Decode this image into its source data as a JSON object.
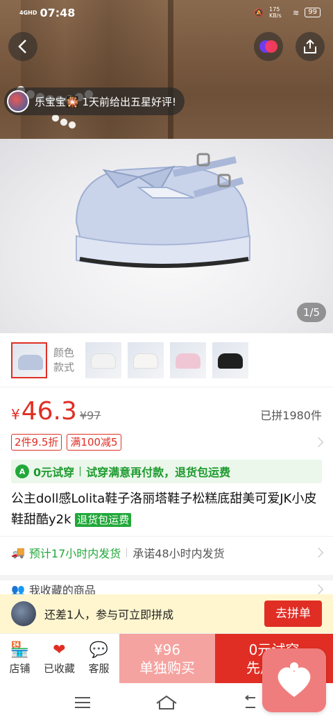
{
  "status_bar": {
    "network": "4GHD",
    "time": "07:48",
    "speed": "175 KB/s",
    "battery": "99"
  },
  "hero": {
    "toast_text": "乐宝宝🎇 1天前给出五星好评!",
    "image_counter": "1/5"
  },
  "variants": {
    "label_line1": "颜色",
    "label_line2": "款式",
    "thumb_colors": [
      "#b9c6dd",
      "#f2f2f2",
      "#f7f5f3",
      "#f1c6d4",
      "#1f1f1f"
    ]
  },
  "price": {
    "symbol": "¥",
    "current": "46.3",
    "original": "¥97",
    "sold": "已拼1980件"
  },
  "promos": [
    "2件9.5折",
    "满100减5"
  ],
  "trial": {
    "icon_letter": "A",
    "label": "0元试穿",
    "text": "试穿满意再付款，退货包运费"
  },
  "product": {
    "title": "公主doll感Lolita鞋子洛丽塔鞋子松糕底甜美可爱JK小皮鞋甜酷y2k",
    "tag": "退货包运费"
  },
  "shipping": {
    "estimate": "预计17小时内发货",
    "promise": "承诺48小时内发货"
  },
  "favorites": {
    "label": "我收藏的商品"
  },
  "group": {
    "text": "还差1人，参与可立即拼成",
    "button": "去拼单"
  },
  "bottom_tabs": [
    {
      "label": "店铺"
    },
    {
      "label": "已收藏"
    },
    {
      "label": "客服"
    }
  ],
  "buy_single": {
    "price": "¥96",
    "label": "单独购买"
  },
  "buy_group": {
    "line1": "0元试穿",
    "line2": "先用后付"
  },
  "colors": {
    "accent_red": "#e02e24",
    "accent_green": "#22a83a",
    "group_bar_bg": "#fff6cf"
  }
}
